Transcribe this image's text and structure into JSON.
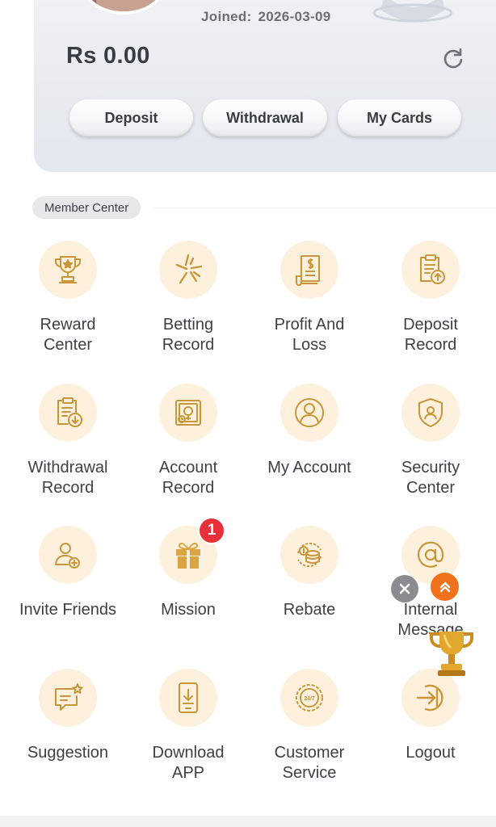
{
  "profile": {
    "joined_label": "Joined:",
    "joined_date": "2026-03-09",
    "balance": "Rs 0.00"
  },
  "actions": {
    "deposit": "Deposit",
    "withdrawal": "Withdrawal",
    "my_cards": "My Cards"
  },
  "member_center": {
    "title": "Member Center",
    "items": [
      {
        "label": "Reward\nCenter",
        "icon": "trophy-icon"
      },
      {
        "label": "Betting\nRecord",
        "icon": "betting-record-icon"
      },
      {
        "label": "Profit And\nLoss",
        "icon": "profit-loss-icon"
      },
      {
        "label": "Deposit\nRecord",
        "icon": "deposit-record-icon"
      },
      {
        "label": "Withdrawal\nRecord",
        "icon": "withdrawal-record-icon"
      },
      {
        "label": "Account\nRecord",
        "icon": "account-record-icon"
      },
      {
        "label": "My Account",
        "icon": "user-icon"
      },
      {
        "label": "Security\nCenter",
        "icon": "shield-icon"
      },
      {
        "label": "Invite Friends",
        "icon": "invite-friends-icon"
      },
      {
        "label": "Mission",
        "icon": "gift-icon",
        "badge": "1"
      },
      {
        "label": "Rebate",
        "icon": "coins-icon"
      },
      {
        "label": "Internal\nMessage",
        "icon": "at-sign-icon"
      },
      {
        "label": "Suggestion",
        "icon": "suggestion-icon"
      },
      {
        "label": "Download\nAPP",
        "icon": "download-app-icon"
      },
      {
        "label": "Customer\nService",
        "icon": "customer-service-icon"
      },
      {
        "label": "Logout",
        "icon": "logout-icon"
      }
    ]
  },
  "colors": {
    "accent": "#d9a441",
    "icon_bg": "#fdf1dd",
    "badge": "#e8303b",
    "float_orange": "#f2711c"
  }
}
